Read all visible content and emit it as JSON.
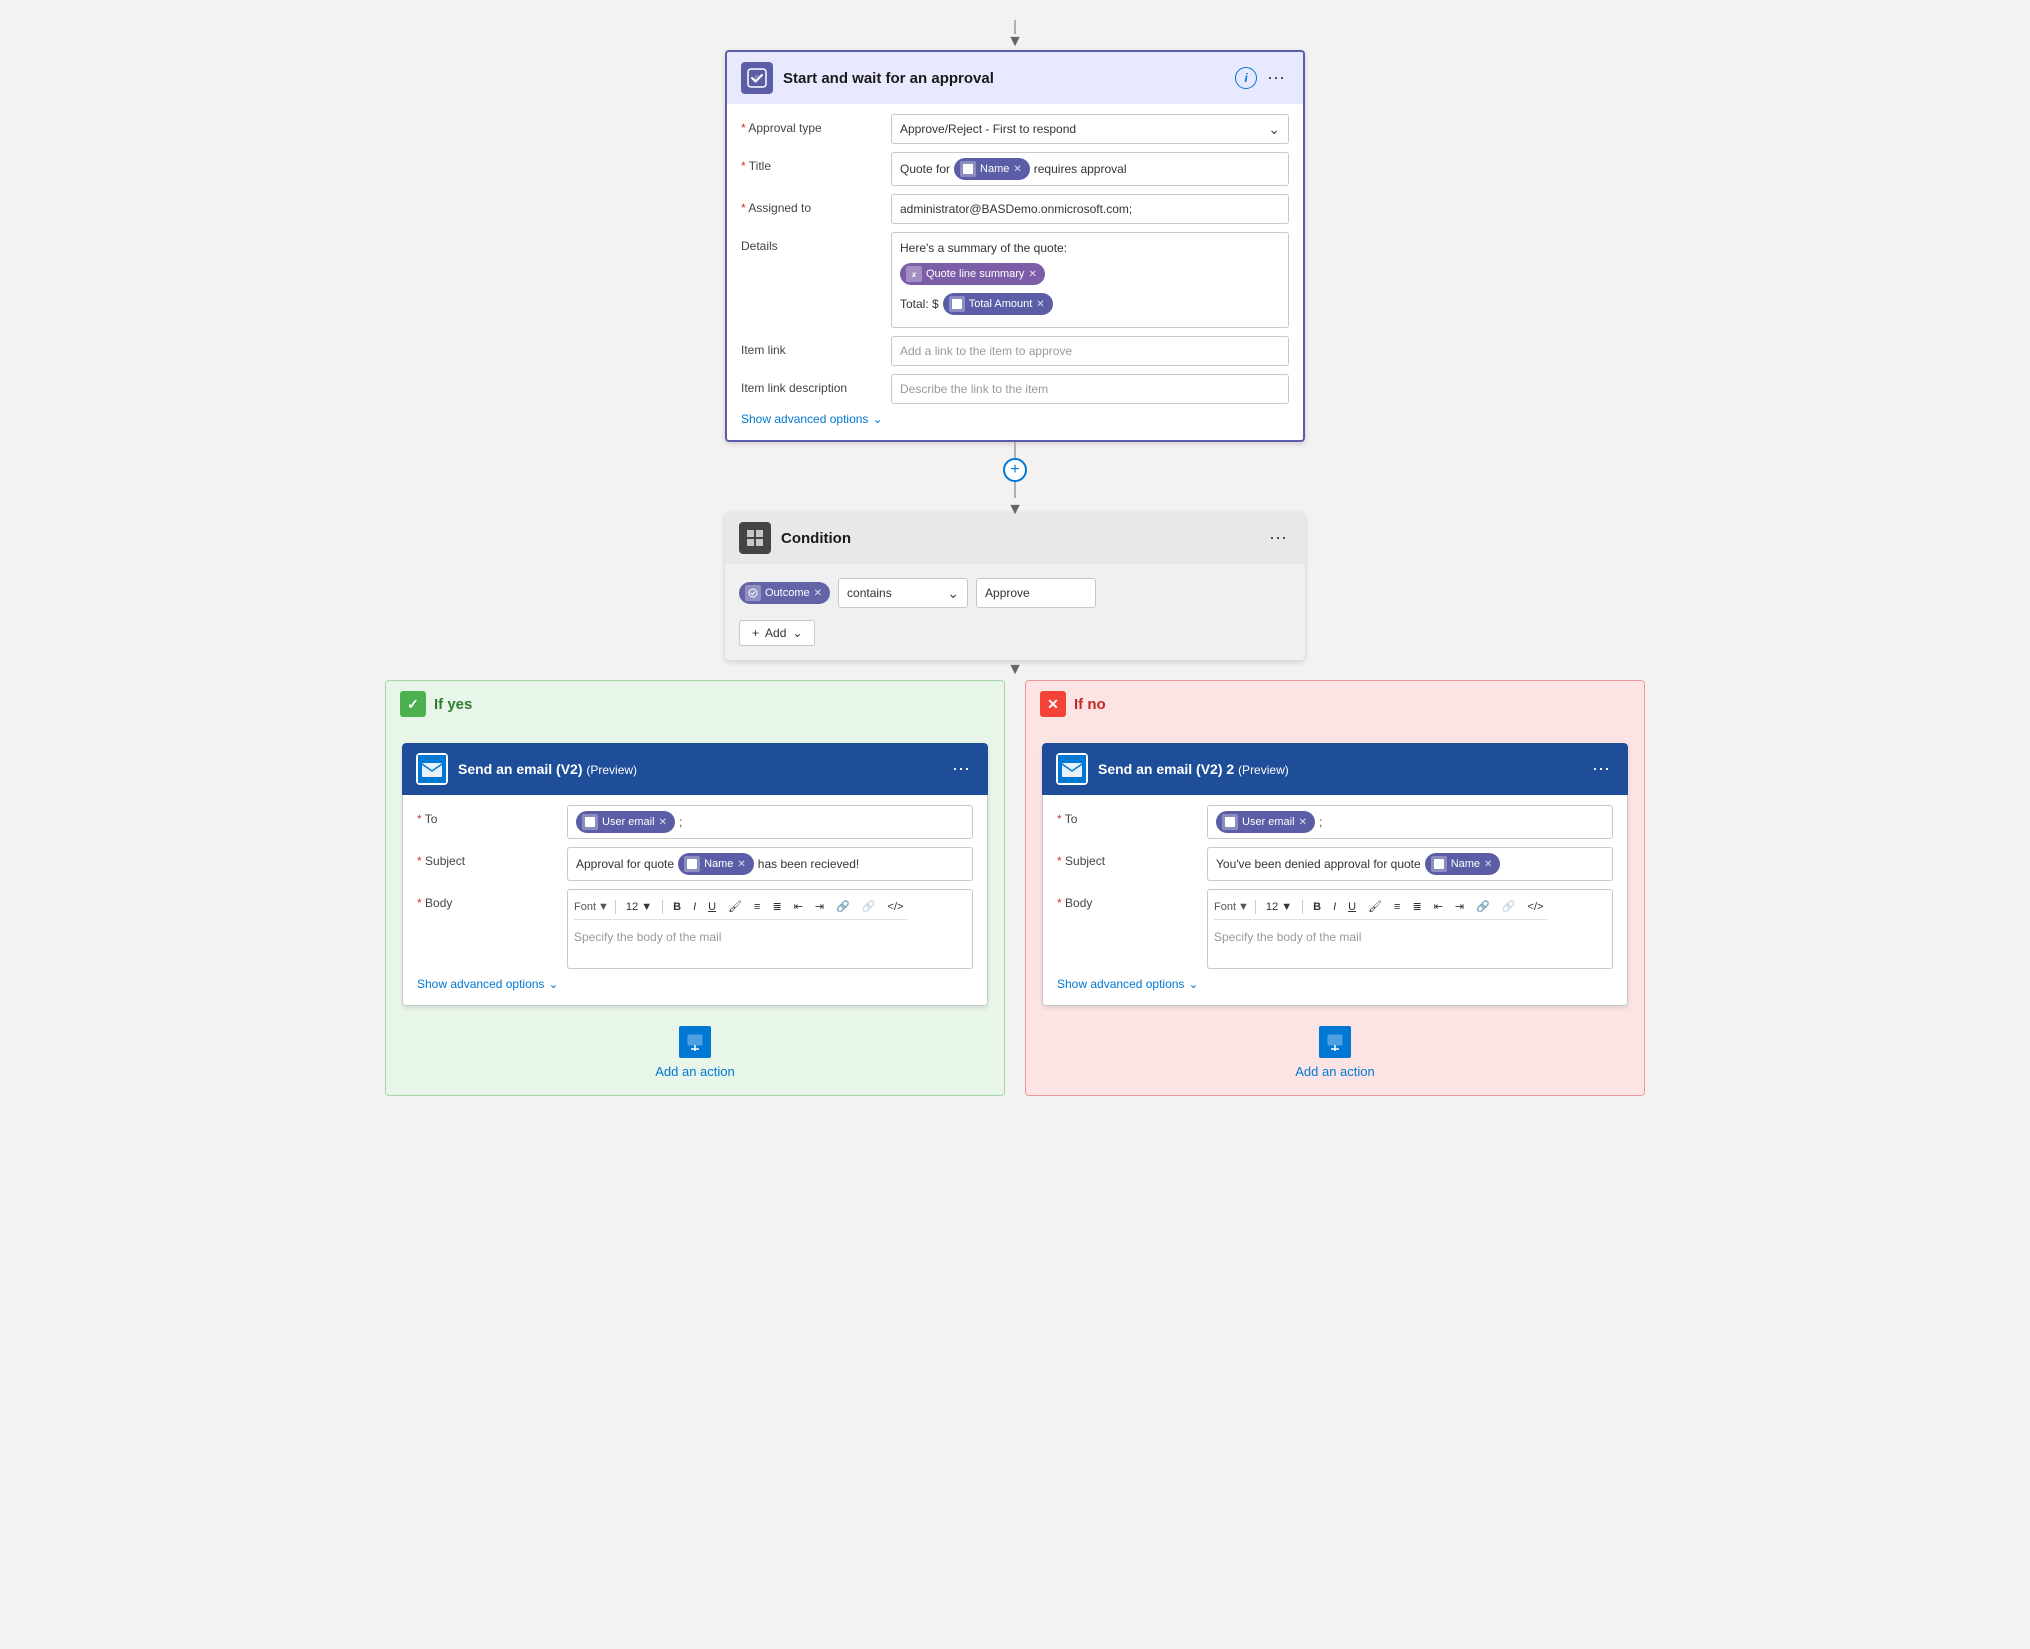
{
  "approval_card": {
    "title": "Start and wait for an approval",
    "approval_type_label": "Approval type",
    "approval_type_value": "Approve/Reject - First to respond",
    "title_label": "Title",
    "title_prefix": "Quote for",
    "title_token": "Name",
    "title_suffix": "requires approval",
    "assigned_label": "Assigned to",
    "assigned_value": "administrator@BASDemo.onmicrosoft.com;",
    "details_label": "Details",
    "details_line1": "Here's a summary of the quote:",
    "details_token1": "Quote line summary",
    "details_line2": "Total: $",
    "details_token2": "Total Amount",
    "item_link_label": "Item link",
    "item_link_placeholder": "Add a link to the item to approve",
    "item_link_desc_label": "Item link description",
    "item_link_desc_placeholder": "Describe the link to the item",
    "show_advanced": "Show advanced options"
  },
  "condition_card": {
    "title": "Condition",
    "token": "Outcome",
    "operator": "contains",
    "value": "Approve",
    "add_btn": "Add"
  },
  "branch_yes": {
    "label": "If yes",
    "email_title": "Send an email (V2)",
    "email_subtitle": "(Preview)",
    "to_label": "To",
    "to_token": "User email",
    "subject_label": "Subject",
    "subject_prefix": "Approval for quote",
    "subject_token": "Name",
    "subject_suffix": "has been recieved!",
    "body_label": "Body",
    "font_label": "Font",
    "font_size": "12",
    "body_placeholder": "Specify the body of the mail",
    "show_advanced": "Show advanced options",
    "add_action": "Add an action"
  },
  "branch_no": {
    "label": "If no",
    "email_title": "Send an email (V2) 2",
    "email_subtitle": "(Preview)",
    "to_label": "To",
    "to_token": "User email",
    "subject_label": "Subject",
    "subject_prefix": "You've been denied approval for quote",
    "subject_token": "Name",
    "body_label": "Body",
    "font_label": "Font",
    "font_size": "12",
    "body_placeholder": "Specify the body of the mail",
    "show_advanced": "Show advanced options",
    "add_action": "Add an action"
  },
  "colors": {
    "purple": "#5b5ea6",
    "violet": "#7b5ea7",
    "blue_dark": "#1e4d9a",
    "green": "#4caf50",
    "red": "#f44336",
    "link": "#0078d4"
  }
}
